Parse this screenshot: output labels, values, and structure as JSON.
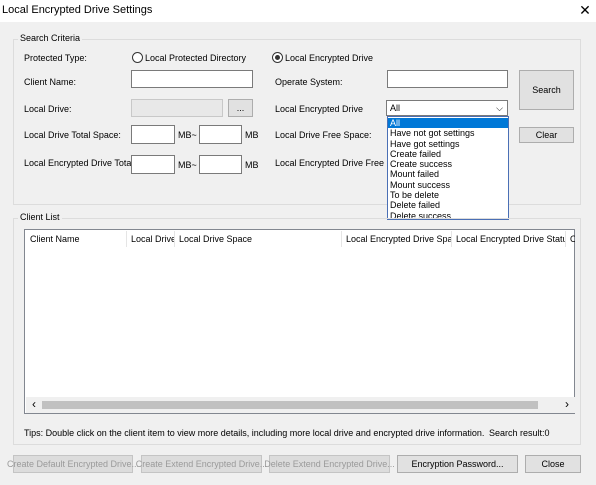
{
  "window": {
    "title": "Local Encrypted Drive Settings",
    "close_glyph": "✕"
  },
  "search_criteria": {
    "group_label": "Search Criteria",
    "protected_type_label": "Protected Type:",
    "radio_local_protected_directory": "Local Protected Directory",
    "radio_local_encrypted_drive": "Local Encrypted Drive",
    "selected_radio": "Local Encrypted Drive",
    "client_name_label": "Client Name:",
    "client_name_value": "",
    "operate_system_label": "Operate System:",
    "operate_system_value": "",
    "local_drive_label": "Local Drive:",
    "local_drive_value": "",
    "browse_button": "...",
    "local_encrypted_drive_label": "Local Encrypted Drive",
    "status_selected": "All",
    "status_options": [
      "All",
      "Have not got settings",
      "Have got settings",
      "Create failed",
      "Create success",
      "Mount failed",
      "Mount success",
      "To be delete",
      "Delete failed",
      "Delete success"
    ],
    "total_space_label": "Local Drive Total Space:",
    "free_space_label": "Local Drive Free Space:",
    "enc_total_label": "Local Encrypted Drive Total",
    "enc_free_label": "Local Encrypted Drive Free",
    "unit_mb_tilde": "MB~",
    "unit_mb": "MB",
    "search_button": "Search",
    "clear_button": "Clear"
  },
  "client_list": {
    "group_label": "Client List",
    "columns": [
      "Client Name",
      "Local Drive",
      "Local Drive Space",
      "Local Encrypted Drive Space",
      "Local Encrypted Drive Status",
      "O"
    ],
    "scroll_left": "‹",
    "scroll_right": "›"
  },
  "footer": {
    "tips": "Tips: Double click on the client item to view more details, including more local drive and encrypted drive information.",
    "search_result": "Search result:0"
  },
  "buttons": {
    "create_default": "Create Default Encrypted Drive...",
    "create_extend": "Create Extend Encrypted Drive...",
    "delete_extend": "Delete Extend Encrypted Drive...",
    "encryption_password": "Encryption Password...",
    "close": "Close"
  },
  "colors": {
    "background": "#f0f0f0",
    "selection": "#0078d7",
    "dropdown_border": "#4a6fb5"
  }
}
